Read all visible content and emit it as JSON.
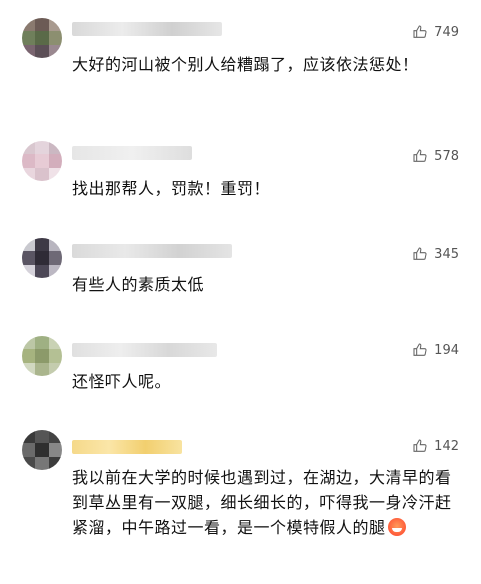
{
  "comments": [
    {
      "likes": "749",
      "text": "大好的河山被个别人给糟蹋了，应该依法惩处！"
    },
    {
      "likes": "578",
      "text": "找出那帮人，罚款！重罚！"
    },
    {
      "likes": "345",
      "text": "有些人的素质太低"
    },
    {
      "likes": "194",
      "text": "还怪吓人呢。"
    },
    {
      "likes": "142",
      "text": "我以前在大学的时候也遇到过，在湖边，大清早的看到草丛里有一双腿，细长细长的，吓得我一身冷汗赶紧溜，中午路过一看，是一个模特假人的腿"
    }
  ],
  "icons": {
    "like": "thumbs-up-icon",
    "emoji": "laughing-emoji-icon"
  },
  "colors": {
    "text": "#111111",
    "likes": "#555555",
    "background": "#ffffff"
  }
}
